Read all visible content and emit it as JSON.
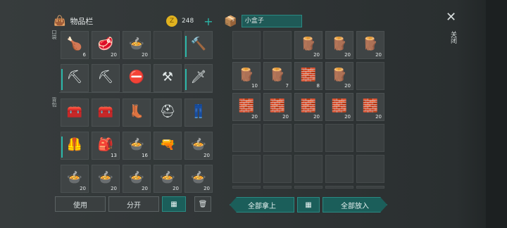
{
  "left_panel": {
    "title": "物品栏",
    "coin_count": "248",
    "plus": "+",
    "pocket_label": "口袋",
    "backpack_label": "背包"
  },
  "right_panel": {
    "container_name": "小盒子"
  },
  "close": {
    "symbol": "✕",
    "label": "关闭"
  },
  "buttons": {
    "use": "使用",
    "split": "分开",
    "take_all": "全部拿上",
    "put_all": "全部放入"
  },
  "left_slots": [
    {
      "icon": "chicken-icon",
      "glyph": "🍗",
      "qty": "6"
    },
    {
      "icon": "raw-meat-icon",
      "glyph": "🥩",
      "qty": "20"
    },
    {
      "icon": "food-bowl-icon",
      "glyph": "🍲",
      "qty": "20"
    },
    {
      "icon": "",
      "glyph": "",
      "qty": ""
    },
    {
      "icon": "hammer-icon",
      "glyph": "🔨",
      "qty": ""
    },
    {
      "icon": "pickaxe-icon",
      "glyph": "⛏",
      "qty": ""
    },
    {
      "icon": "pickaxe-icon",
      "glyph": "⛏",
      "qty": ""
    },
    {
      "icon": "stop-sign-icon",
      "glyph": "⛔",
      "qty": ""
    },
    {
      "icon": "shovel-icon",
      "glyph": "⚒",
      "qty": ""
    },
    {
      "icon": "machete-icon",
      "glyph": "🗡",
      "qty": ""
    },
    {
      "icon": "toolbox-icon",
      "glyph": "🧰",
      "qty": ""
    },
    {
      "icon": "toolbox-icon",
      "glyph": "🧰",
      "qty": ""
    },
    {
      "icon": "boots-icon",
      "glyph": "👢",
      "qty": ""
    },
    {
      "icon": "helmet-icon",
      "glyph": "⛑",
      "qty": ""
    },
    {
      "icon": "pants-icon",
      "glyph": "👖",
      "qty": ""
    },
    {
      "icon": "vest-icon",
      "glyph": "🦺",
      "qty": ""
    },
    {
      "icon": "medkit-icon",
      "glyph": "🎒",
      "qty": "13"
    },
    {
      "icon": "food-bowl-icon",
      "glyph": "🍲",
      "qty": "16"
    },
    {
      "icon": "pistol-icon",
      "glyph": "🔫",
      "qty": ""
    },
    {
      "icon": "food-bowl-icon",
      "glyph": "🍲",
      "qty": "20"
    },
    {
      "icon": "food-bowl-icon",
      "glyph": "🍲",
      "qty": "20"
    },
    {
      "icon": "food-bowl-icon",
      "glyph": "🍲",
      "qty": "20"
    },
    {
      "icon": "food-bowl-icon",
      "glyph": "🍲",
      "qty": "20"
    },
    {
      "icon": "food-bowl-icon",
      "glyph": "🍲",
      "qty": "20"
    },
    {
      "icon": "food-bowl-icon",
      "glyph": "🍲",
      "qty": "20"
    }
  ],
  "right_slots": [
    {
      "icon": "",
      "glyph": "",
      "qty": ""
    },
    {
      "icon": "",
      "glyph": "",
      "qty": ""
    },
    {
      "icon": "wood-plank-icon",
      "glyph": "🪵",
      "qty": "20"
    },
    {
      "icon": "wood-plank-icon",
      "glyph": "🪵",
      "qty": "20"
    },
    {
      "icon": "wood-plank-icon",
      "glyph": "🪵",
      "qty": "20"
    },
    {
      "icon": "wood-plank-icon",
      "glyph": "🪵",
      "qty": "10"
    },
    {
      "icon": "wood-plank-icon",
      "glyph": "🪵",
      "qty": "7"
    },
    {
      "icon": "stone-block-icon",
      "glyph": "🧱",
      "qty": "8"
    },
    {
      "icon": "wood-plank-icon",
      "glyph": "🪵",
      "qty": "20"
    },
    {
      "icon": "",
      "glyph": "",
      "qty": ""
    },
    {
      "icon": "stone-block-icon",
      "glyph": "🧱",
      "qty": "20"
    },
    {
      "icon": "stone-block-icon",
      "glyph": "🧱",
      "qty": "20"
    },
    {
      "icon": "stone-block-icon",
      "glyph": "🧱",
      "qty": "20"
    },
    {
      "icon": "stone-block-icon",
      "glyph": "🧱",
      "qty": "20"
    },
    {
      "icon": "stone-block-icon",
      "glyph": "🧱",
      "qty": "20"
    },
    {
      "icon": "",
      "glyph": "",
      "qty": ""
    },
    {
      "icon": "",
      "glyph": "",
      "qty": ""
    },
    {
      "icon": "",
      "glyph": "",
      "qty": ""
    },
    {
      "icon": "",
      "glyph": "",
      "qty": ""
    },
    {
      "icon": "",
      "glyph": "",
      "qty": ""
    },
    {
      "icon": "",
      "glyph": "",
      "qty": ""
    },
    {
      "icon": "",
      "glyph": "",
      "qty": ""
    },
    {
      "icon": "",
      "glyph": "",
      "qty": ""
    },
    {
      "icon": "",
      "glyph": "",
      "qty": ""
    },
    {
      "icon": "",
      "glyph": "",
      "qty": ""
    },
    {
      "icon": "",
      "glyph": "",
      "qty": ""
    },
    {
      "icon": "",
      "glyph": "",
      "qty": ""
    },
    {
      "icon": "",
      "glyph": "",
      "qty": ""
    },
    {
      "icon": "",
      "glyph": "",
      "qty": ""
    },
    {
      "icon": "",
      "glyph": "",
      "qty": ""
    }
  ],
  "colors": {
    "accent": "#2bb6a8",
    "teal_button": "#1b5e5a",
    "coin": "#e0b21f"
  }
}
